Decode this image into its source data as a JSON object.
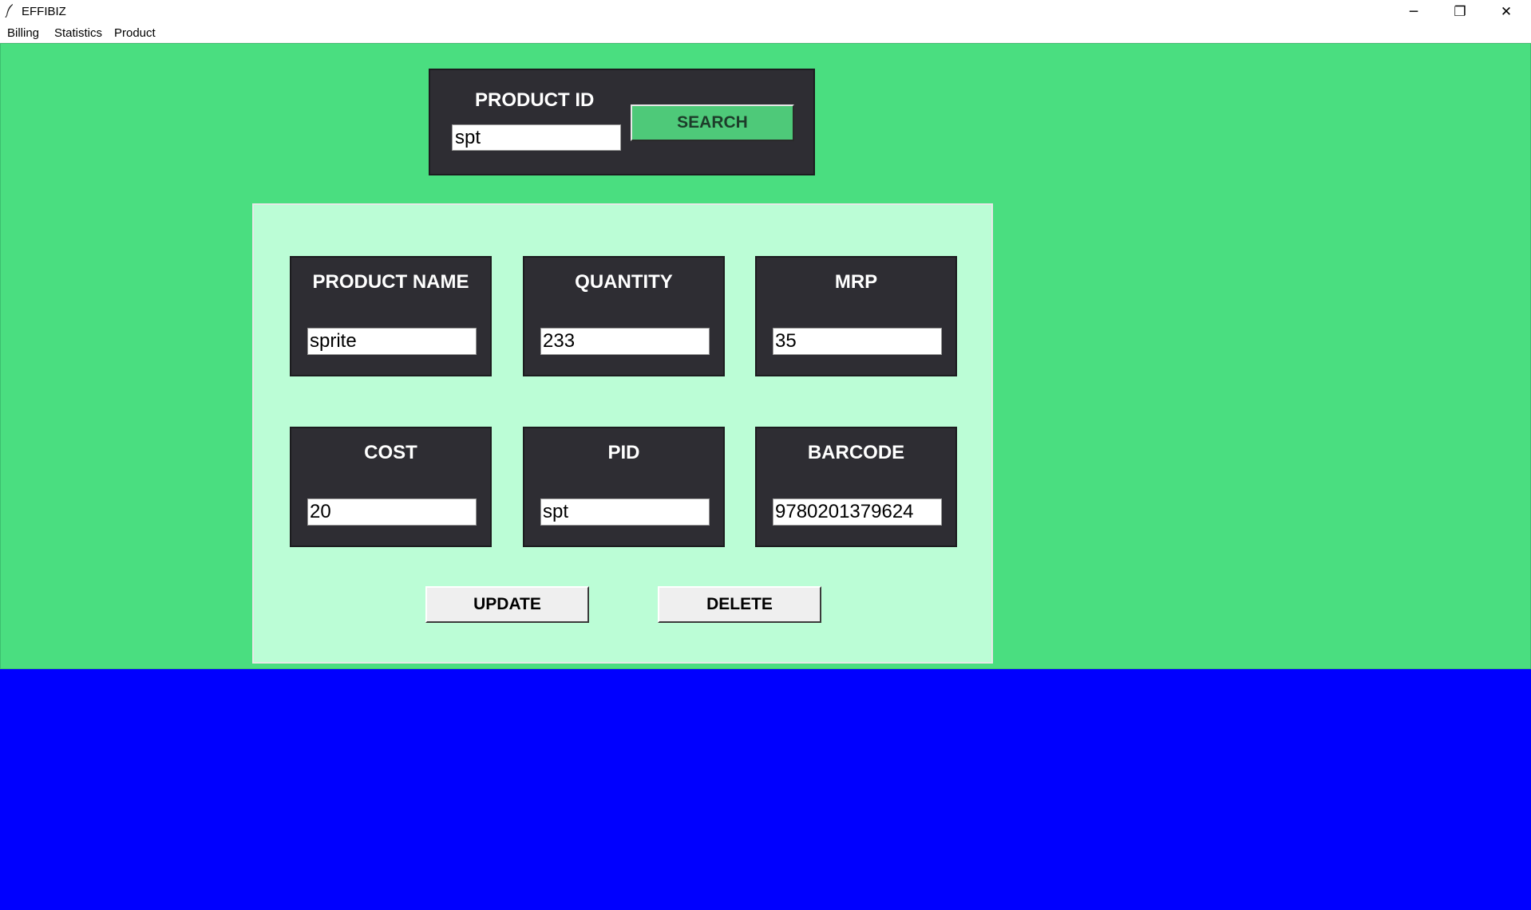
{
  "window": {
    "title": "EFFIBIZ",
    "minimize_glyph": "─",
    "maximize_glyph": "❐",
    "close_glyph": "✕"
  },
  "menu": {
    "items": [
      {
        "label": "Billing"
      },
      {
        "label": "Statistics"
      },
      {
        "label": "Product"
      }
    ]
  },
  "search": {
    "label": "PRODUCT ID",
    "value": "spt",
    "button_label": "SEARCH"
  },
  "fields": [
    {
      "label": "PRODUCT NAME",
      "value": "sprite"
    },
    {
      "label": "QUANTITY",
      "value": "233"
    },
    {
      "label": "MRP",
      "value": "35"
    },
    {
      "label": "COST",
      "value": "20"
    },
    {
      "label": "PID",
      "value": "spt"
    },
    {
      "label": "BARCODE",
      "value": "9780201379624"
    }
  ],
  "actions": {
    "update_label": "UPDATE",
    "delete_label": "DELETE"
  },
  "colors": {
    "main_bg": "#4ade80",
    "panel_bg": "#bbfdd6",
    "field_bg": "#2e2d33",
    "search_button": "#4ec979",
    "bottom_bg": "#0000ff"
  }
}
